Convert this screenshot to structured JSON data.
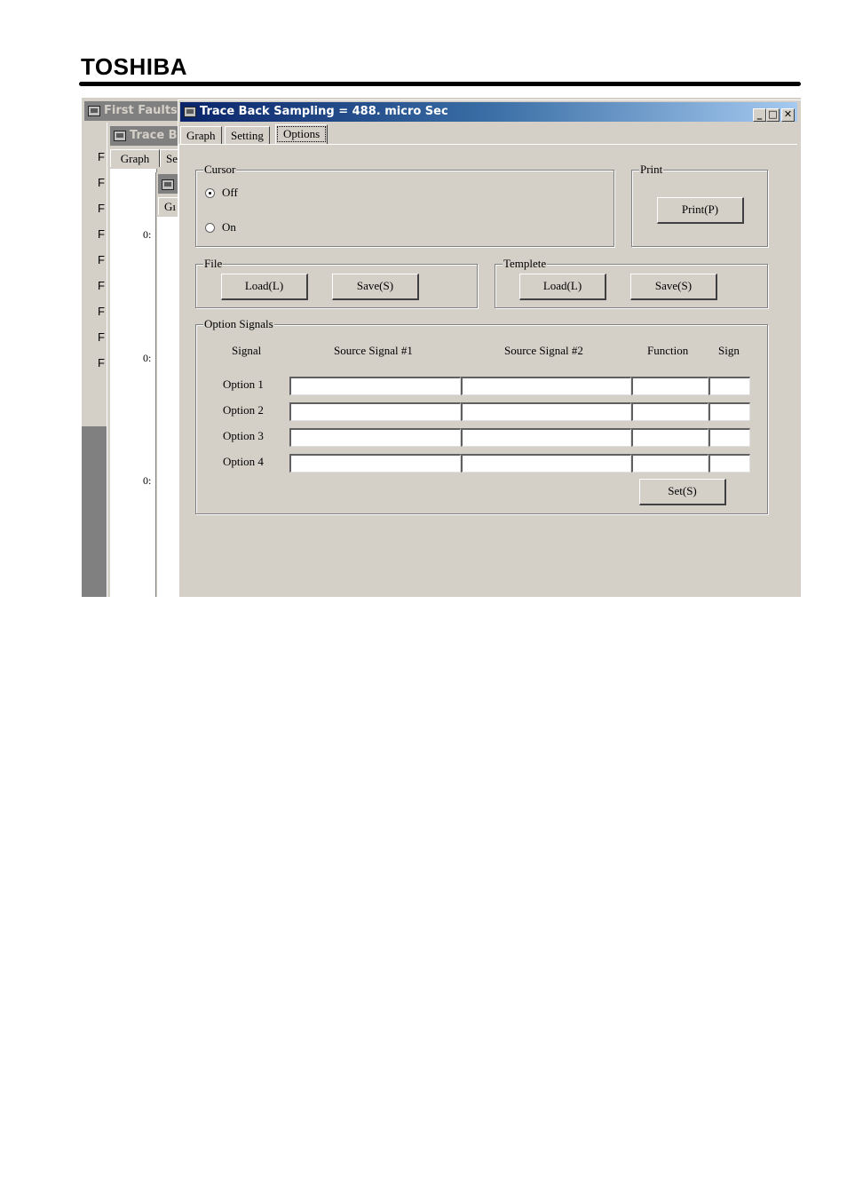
{
  "header": {
    "brand": "TOSHIBA"
  },
  "background_windows": {
    "first_faults": {
      "title": "First Faults",
      "list_letters": [
        "F",
        "F",
        "F",
        "F",
        "F",
        "F",
        "F",
        "F",
        "F"
      ]
    },
    "trace_b": {
      "title": "Trace B",
      "tabs": [
        "Graph",
        "Se"
      ]
    },
    "third": {
      "tab": "Gı",
      "axis_labels": [
        "0:",
        "0:",
        "0:"
      ]
    }
  },
  "window": {
    "title": "Trace Back Sampling = 488. micro Sec",
    "controls": {
      "minimize": "_",
      "maximize": "□",
      "close": "✕"
    },
    "tabs": [
      {
        "label": "Graph",
        "selected": false
      },
      {
        "label": "Setting",
        "selected": false
      },
      {
        "label": "Options",
        "selected": true
      }
    ]
  },
  "options": {
    "cursor": {
      "legend": "Cursor",
      "options": [
        {
          "label": "Off",
          "checked": true
        },
        {
          "label": "On",
          "checked": false
        }
      ]
    },
    "print": {
      "legend": "Print",
      "button": "Print(P)"
    },
    "file": {
      "legend": "File",
      "load": "Load(L)",
      "save": "Save(S)"
    },
    "template": {
      "legend": "Templete",
      "load": "Load(L)",
      "save": "Save(S)"
    },
    "option_signals": {
      "legend": "Option Signals",
      "columns": [
        "Signal",
        "Source Signal #1",
        "Source Signal #2",
        "Function",
        "Sign"
      ],
      "rows": [
        {
          "label": "Option 1",
          "source1": "",
          "source2": "",
          "function": "",
          "sign": ""
        },
        {
          "label": "Option 2",
          "source1": "",
          "source2": "",
          "function": "",
          "sign": ""
        },
        {
          "label": "Option 3",
          "source1": "",
          "source2": "",
          "function": "",
          "sign": ""
        },
        {
          "label": "Option 4",
          "source1": "",
          "source2": "",
          "function": "",
          "sign": ""
        }
      ],
      "set_button": "Set(S)"
    }
  }
}
